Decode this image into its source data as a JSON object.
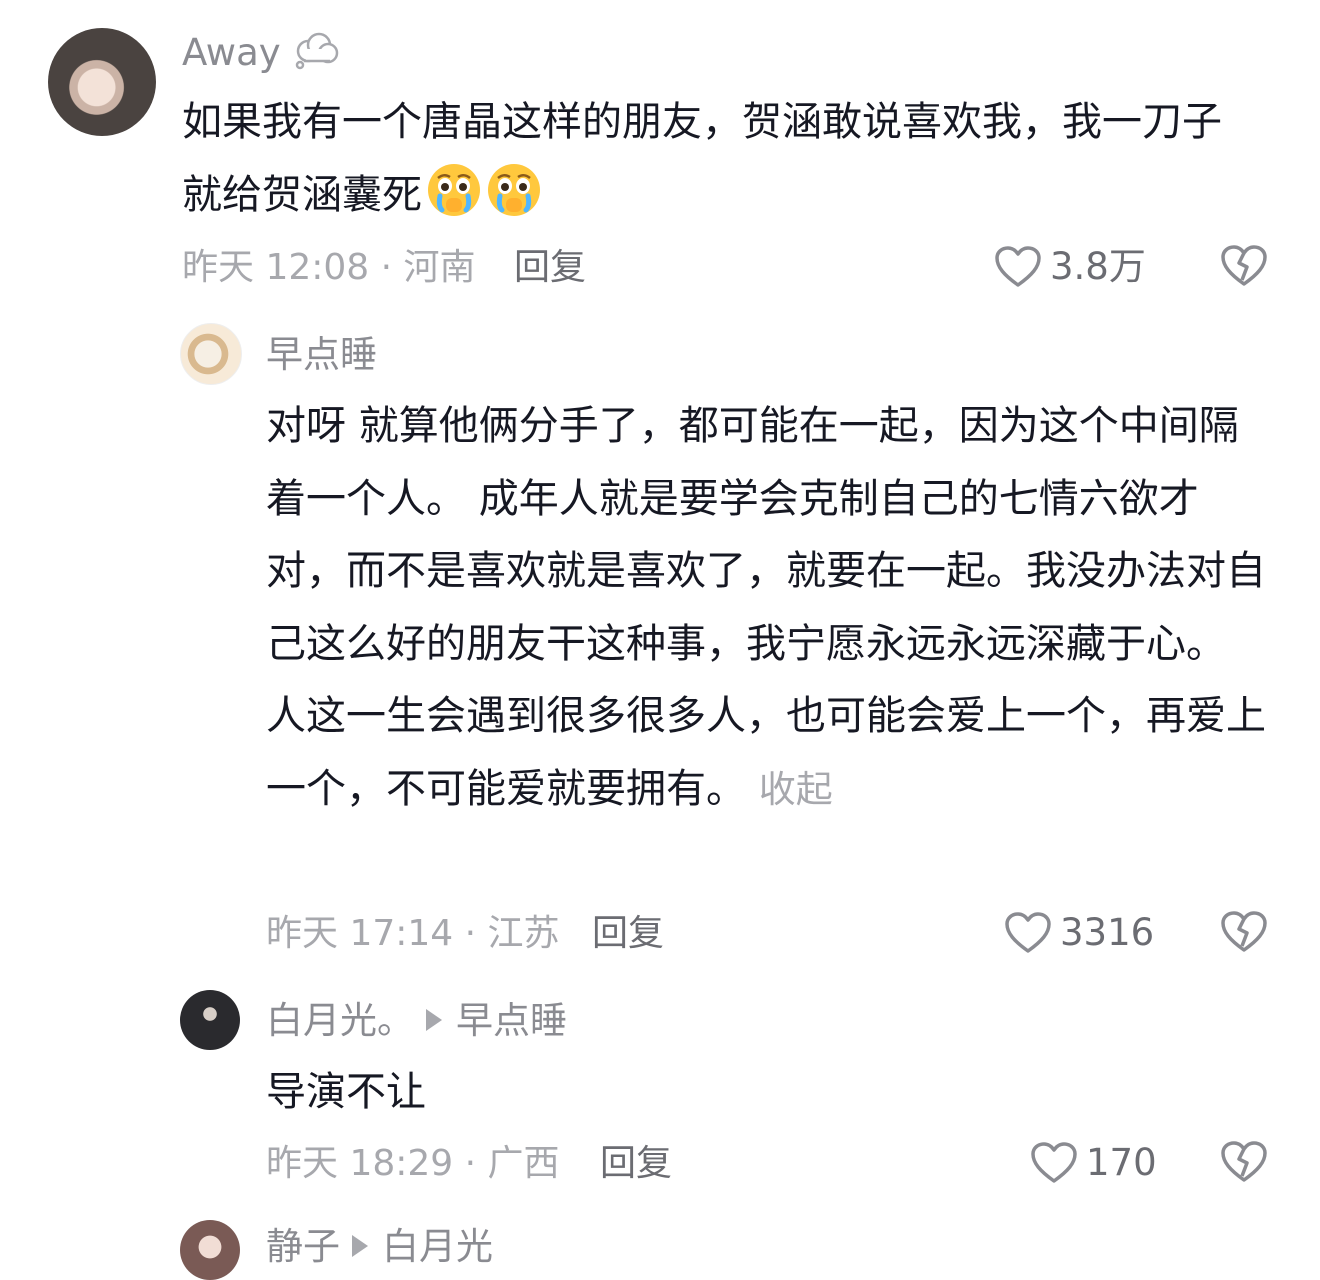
{
  "comments": [
    {
      "author": "Away",
      "text": "如果我有一个唐晶这样的朋友，贺涵敢说喜欢我，我一刀子就给贺涵囊死",
      "emoji": [
        "crying-face-emoji",
        "crying-face-emoji"
      ],
      "time_location": "昨天 12:08 · 河南",
      "reply_label": "回复",
      "likes": "3.8万"
    },
    {
      "author": "早点睡",
      "text": "对呀  就算他俩分手了，都可能在一起，因为这个中间隔着一个人。 成年人就是要学会克制自己的七情六欲才对，而不是喜欢就是喜欢了，就要在一起。我没办法对自己这么好的朋友干这种事，我宁愿永远永远深藏于心。 人这一生会遇到很多很多人，也可能会爱上一个，再爱上一个，不可能爱就要拥有。",
      "collapse_label": "收起",
      "time_location": "昨天 17:14 · 江苏",
      "reply_label": "回复",
      "likes": "3316"
    },
    {
      "author": "白月光。",
      "reply_to": "早点睡",
      "text": "导演不让",
      "time_location": "昨天 18:29 · 广西",
      "reply_label": "回复",
      "likes": "170"
    },
    {
      "author_partial": "静子",
      "reply_to_partial": "白月光"
    }
  ],
  "colors": {
    "primary_text": "#161823",
    "name_text": "#8a8b91",
    "meta_text": "#a7a8ad",
    "action_text": "#6b6c72"
  }
}
